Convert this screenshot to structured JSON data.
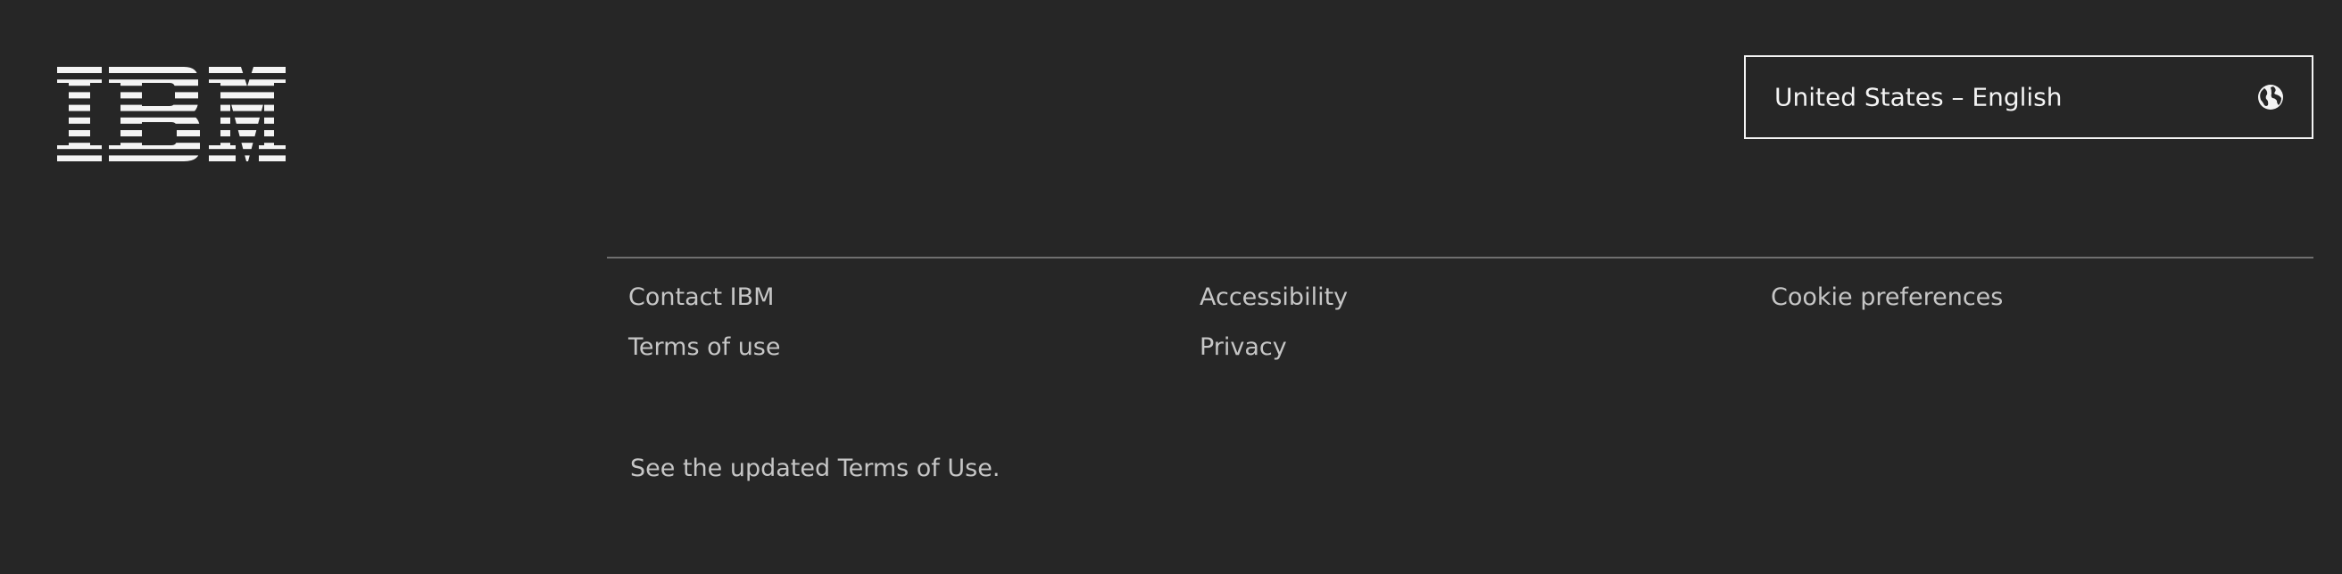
{
  "colors": {
    "background": "#262626",
    "link_text": "#c6c6c6",
    "emphasis_text": "#f4f4f4",
    "divider": "#6f6f6f"
  },
  "logo": {
    "text": "IBM",
    "icon": "ibm-logo-icon"
  },
  "locale_selector": {
    "label": "United States – English",
    "icon": "globe-icon"
  },
  "links": [
    {
      "label": "Contact IBM"
    },
    {
      "label": "Terms of use"
    },
    {
      "label": "Accessibility"
    },
    {
      "label": "Privacy"
    },
    {
      "label": "Cookie preferences"
    }
  ],
  "notice": {
    "text": "See the updated Terms of Use."
  }
}
